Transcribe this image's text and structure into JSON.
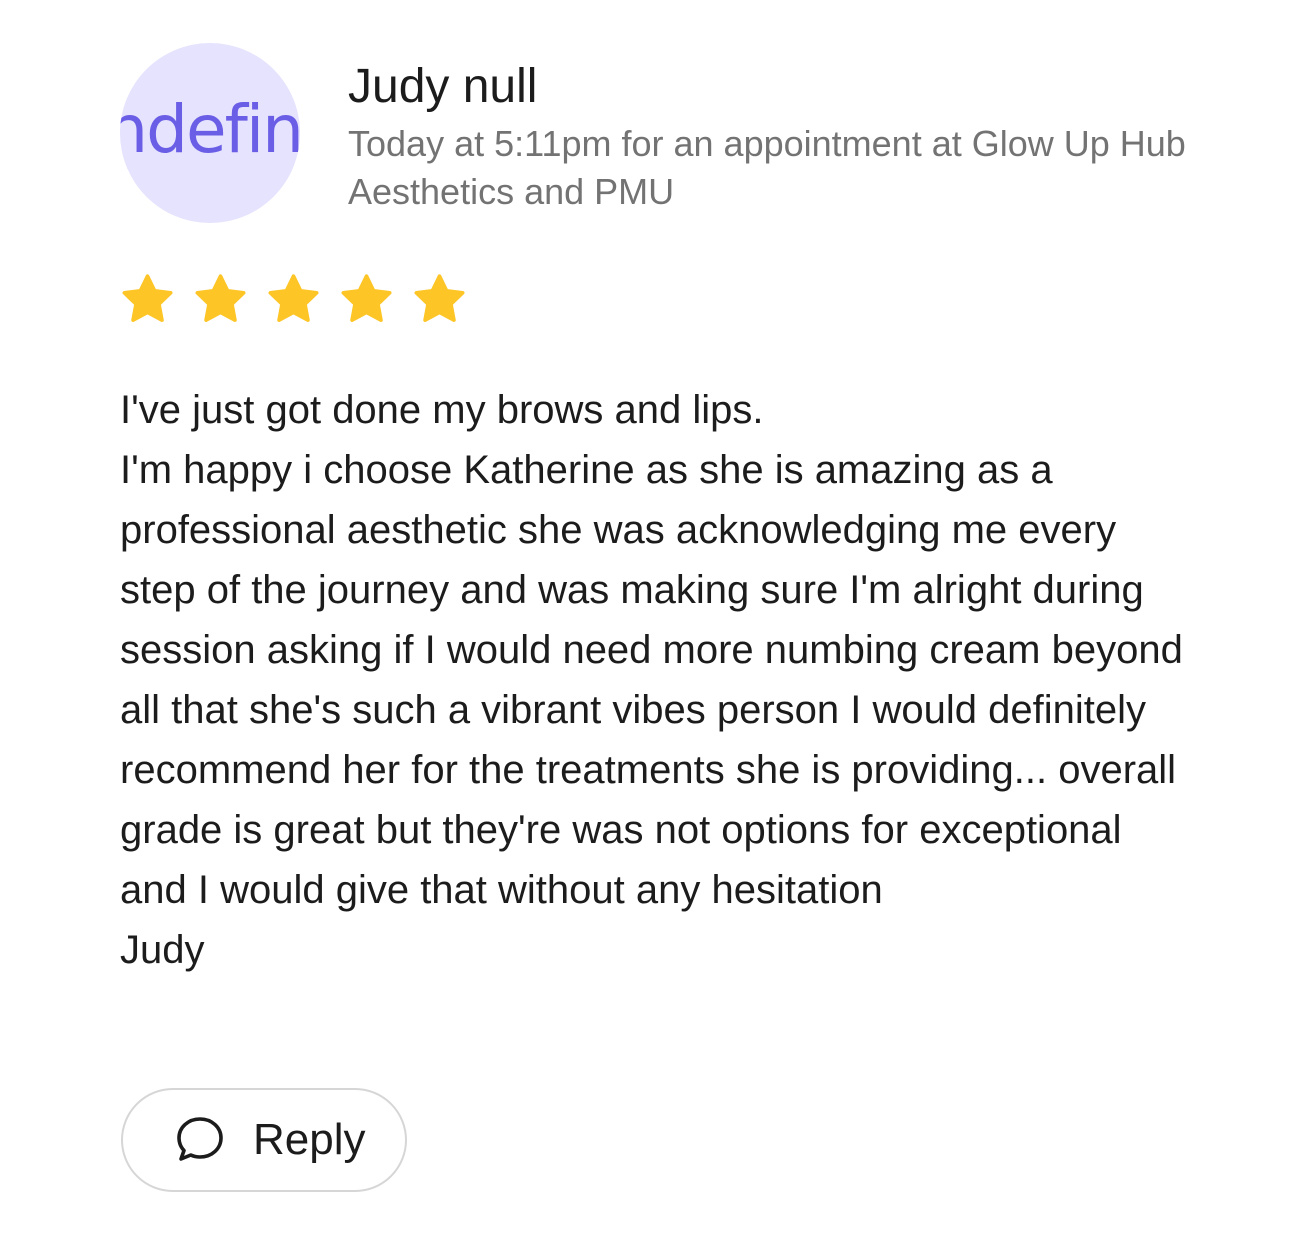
{
  "review": {
    "avatar_text": "ndefin",
    "reviewer_name": "Judy null",
    "meta": "Today at 5:11pm for an appointment at Glow Up Hub Aesthetics and PMU",
    "rating": 5,
    "rating_max": 5,
    "star_color": "#fdc526",
    "avatar_bg_color": "#e5e3fd",
    "avatar_text_color": "#6b5ee6",
    "body": "I've just got done my brows and lips.\nI'm happy i choose Katherine as she is amazing as a professional aesthetic she was acknowledging me every step of the journey and was making sure I'm alright during session asking if I would need more numbing cream beyond all that she's such a vibrant vibes person I would definitely recommend her for the treatments she is providing... overall grade is great but they're was not options for exceptional and I would give that without any hesitation\nJudy"
  },
  "actions": {
    "reply_label": "Reply",
    "reply_icon": "speech-bubble-icon"
  }
}
